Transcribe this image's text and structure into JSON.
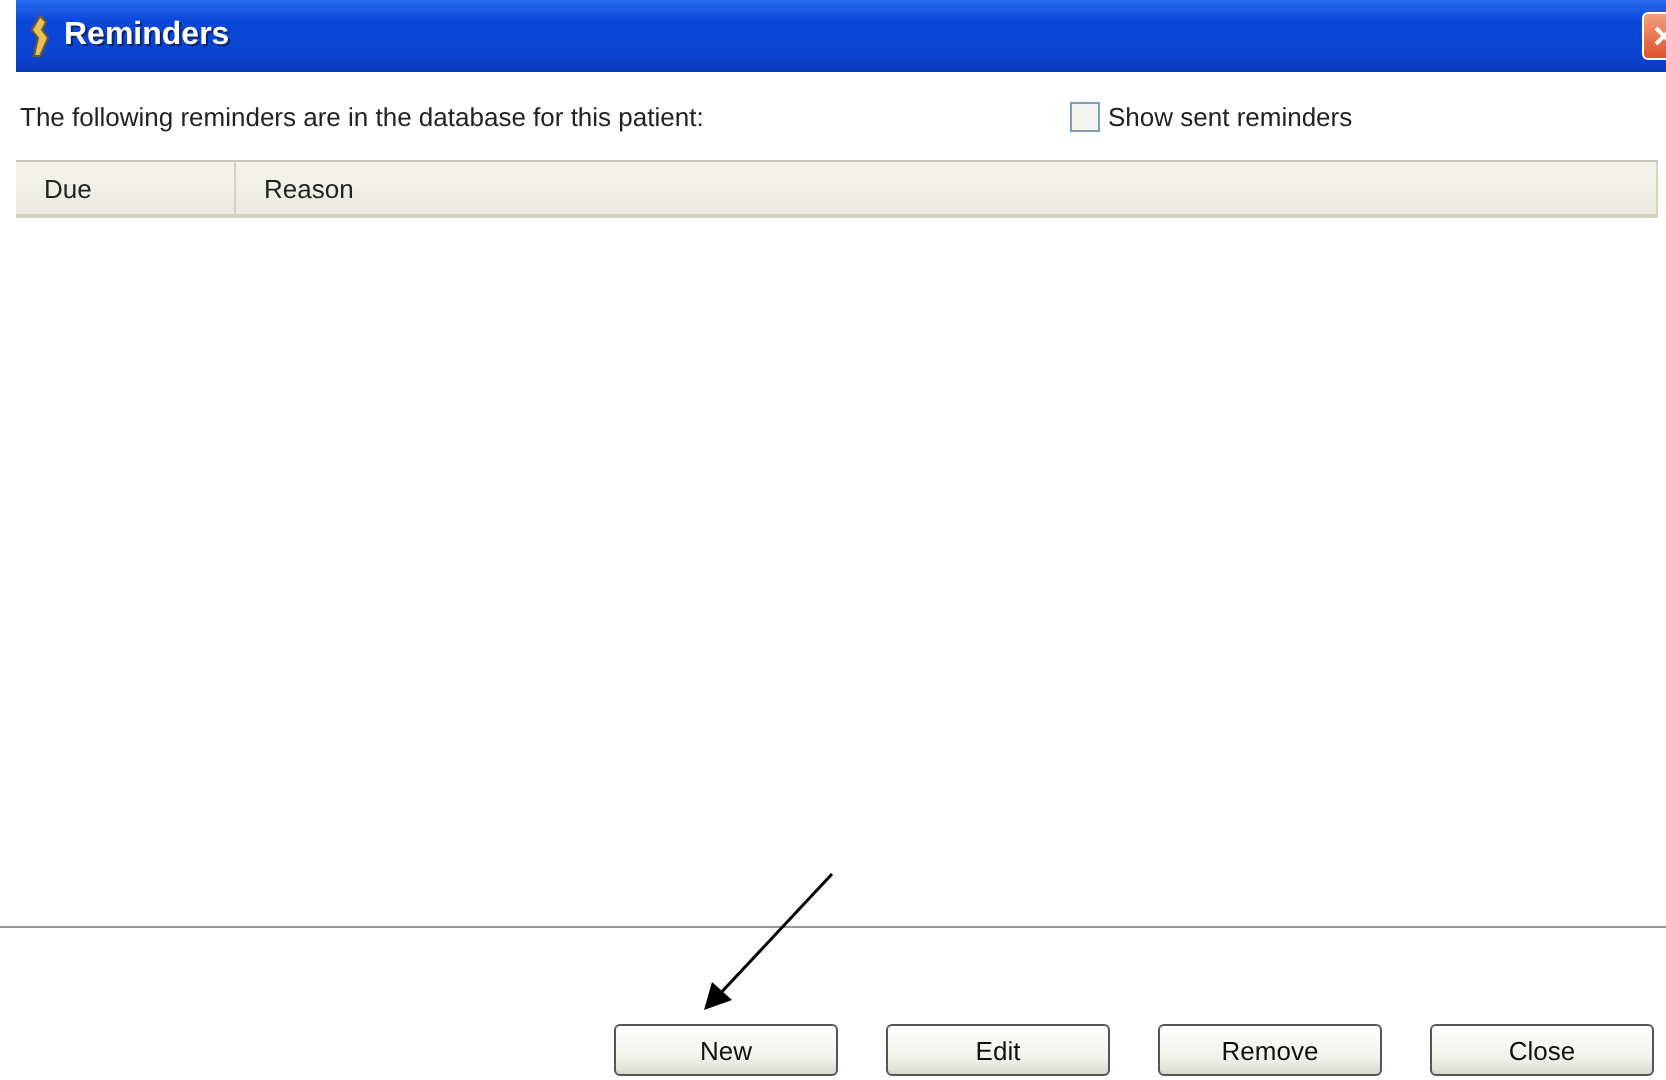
{
  "window": {
    "title": "Reminders"
  },
  "intro": "The following reminders are in the database for this patient:",
  "show_sent": {
    "label": "Show sent reminders",
    "checked": false
  },
  "table": {
    "columns": [
      "Due",
      "Reason"
    ]
  },
  "buttons": [
    "New",
    "Edit",
    "Remove",
    "Close"
  ]
}
